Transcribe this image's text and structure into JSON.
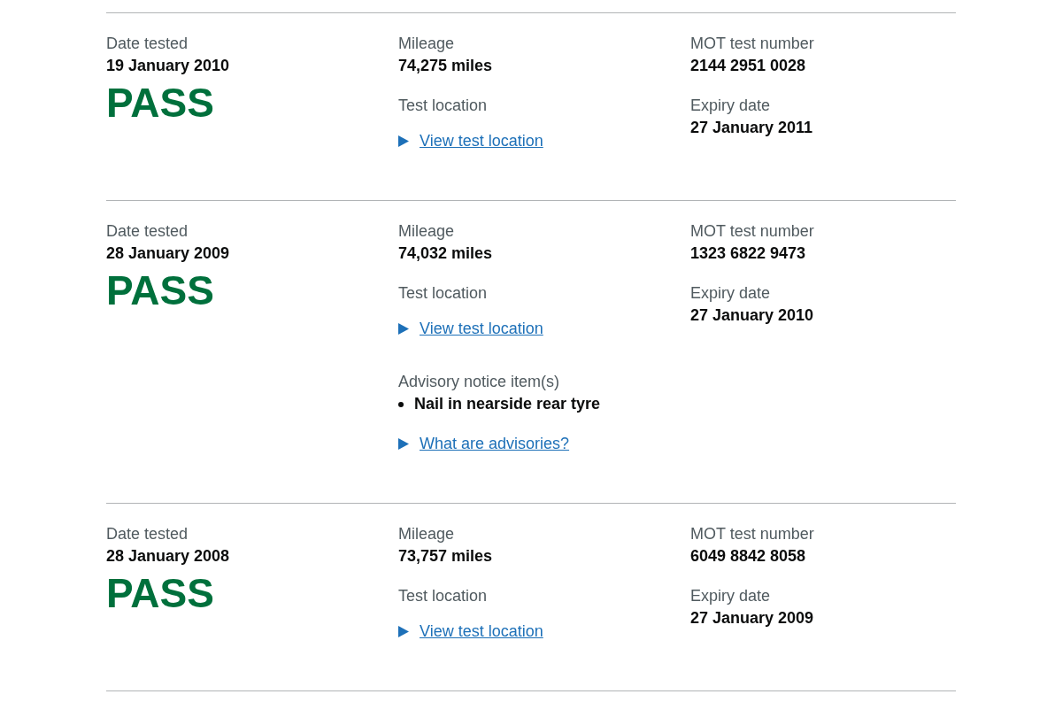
{
  "tests": [
    {
      "date_label": "Date tested",
      "date": "19 January 2010",
      "result": "PASS",
      "mileage_label": "Mileage",
      "mileage": "74,275 miles",
      "location_label": "Test location",
      "location_link": "View test location",
      "number_label": "MOT test number",
      "number": "2144 2951 0028",
      "expiry_label": "Expiry date",
      "expiry": "27 January 2011"
    },
    {
      "date_label": "Date tested",
      "date": "28 January 2009",
      "result": "PASS",
      "mileage_label": "Mileage",
      "mileage": "74,032 miles",
      "location_label": "Test location",
      "location_link": "View test location",
      "advisory": {
        "label": "Advisory notice item(s)",
        "items": [
          "Nail in nearside rear tyre"
        ],
        "link": "What are advisories?"
      },
      "number_label": "MOT test number",
      "number": "1323 6822 9473",
      "expiry_label": "Expiry date",
      "expiry": "27 January 2010"
    },
    {
      "date_label": "Date tested",
      "date": "28 January 2008",
      "result": "PASS",
      "mileage_label": "Mileage",
      "mileage": "73,757 miles",
      "location_label": "Test location",
      "location_link": "View test location",
      "number_label": "MOT test number",
      "number": "6049 8842 8058",
      "expiry_label": "Expiry date",
      "expiry": "27 January 2009"
    }
  ]
}
